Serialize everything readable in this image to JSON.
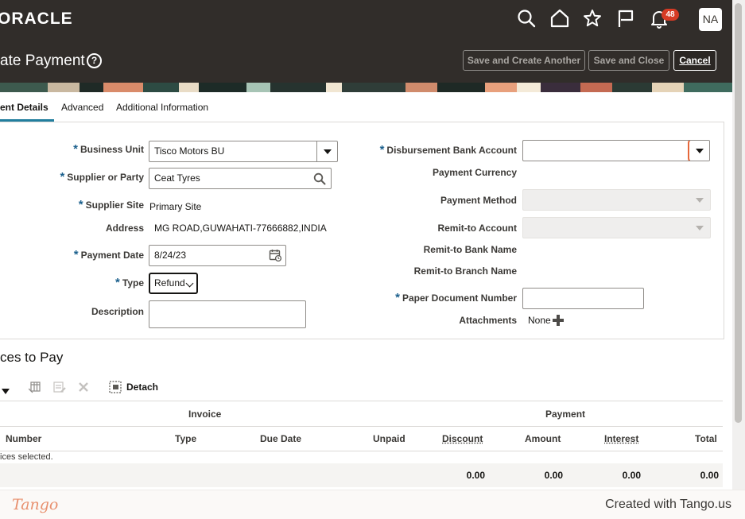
{
  "header": {
    "logo_text": "ORACLE",
    "notification_count": "48",
    "avatar_initials": "NA"
  },
  "title_bar": {
    "title": "ate Payment",
    "help_glyph": "?",
    "buttons": {
      "save_and_create_another": "Save and Create Another",
      "save_and_close": "Save and Close",
      "cancel": "Cancel"
    }
  },
  "tabs": [
    {
      "label": "ent Details",
      "active": true
    },
    {
      "label": "Advanced",
      "active": false
    },
    {
      "label": "Additional Information",
      "active": false
    }
  ],
  "form_left": {
    "business_unit": {
      "label": "Business Unit",
      "value": "Tisco Motors BU"
    },
    "supplier_or_party": {
      "label": "Supplier or Party",
      "value": "Ceat Tyres"
    },
    "supplier_site": {
      "label": "Supplier Site",
      "value": "Primary Site"
    },
    "address": {
      "label": "Address",
      "value": "MG ROAD,GUWAHATI-77666882,INDIA"
    },
    "payment_date": {
      "label": "Payment Date",
      "value": "8/24/23"
    },
    "type": {
      "label": "Type",
      "value": "Refund"
    },
    "description": {
      "label": "Description",
      "value": ""
    }
  },
  "form_right": {
    "disbursement_bank_account": {
      "label": "Disbursement Bank Account",
      "value": ""
    },
    "payment_currency": {
      "label": "Payment Currency"
    },
    "payment_method": {
      "label": "Payment Method",
      "value": ""
    },
    "remit_to_account": {
      "label": "Remit-to Account",
      "value": ""
    },
    "remit_to_bank_name": {
      "label": "Remit-to Bank Name"
    },
    "remit_to_branch_name": {
      "label": "Remit-to Branch Name"
    },
    "paper_document_number": {
      "label": "Paper Document Number",
      "value": ""
    },
    "attachments": {
      "label": "Attachments",
      "value": "None"
    }
  },
  "invoices": {
    "title": "ces to Pay",
    "toolbar": {
      "detach_label": "Detach"
    },
    "column_groups": {
      "invoice": "Invoice",
      "payment": "Payment"
    },
    "columns": {
      "number": "Number",
      "type": "Type",
      "due_date": "Due Date",
      "unpaid": "Unpaid",
      "discount": "Discount",
      "amount": "Amount",
      "interest": "Interest",
      "total": "Total"
    },
    "empty_message": "ices selected.",
    "totals": {
      "discount": "0.00",
      "amount": "0.00",
      "interest": "0.00",
      "total": "0.00"
    }
  },
  "footer": {
    "logo": "Tango",
    "credit": "Created with Tango.us"
  },
  "colors": {
    "header_bg": "#312d2a",
    "required_marker": "#1a5f8c",
    "highlight": "#e6673a",
    "badge": "#d63b25",
    "tab_underline": "#227e9e"
  }
}
